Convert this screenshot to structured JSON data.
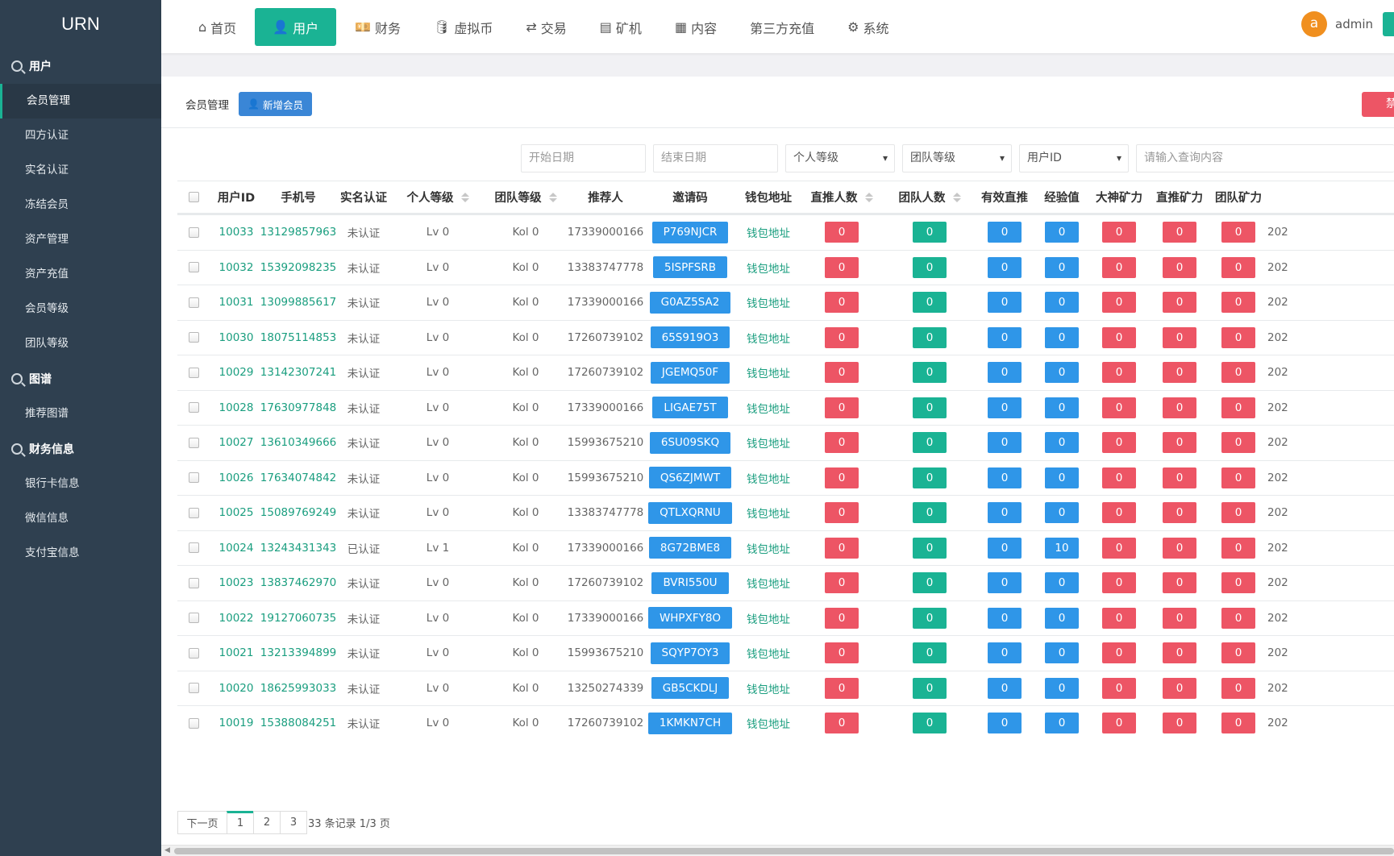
{
  "brand": "URN",
  "sidebar": {
    "groups": [
      {
        "label": "用户",
        "items": [
          "会员管理",
          "四方认证",
          "实名认证",
          "冻结会员",
          "资产管理",
          "资产充值",
          "会员等级",
          "团队等级"
        ]
      },
      {
        "label": "图谱",
        "items": [
          "推荐图谱"
        ]
      },
      {
        "label": "财务信息",
        "items": [
          "银行卡信息",
          "微信信息",
          "支付宝信息"
        ]
      }
    ],
    "active_item": "会员管理"
  },
  "topnav": {
    "items": [
      {
        "label": "首页",
        "icon": "home-icon",
        "glyph": "⌂"
      },
      {
        "label": "用户",
        "icon": "user-icon",
        "glyph": "👤"
      },
      {
        "label": "财务",
        "icon": "money-icon",
        "glyph": "💴"
      },
      {
        "label": "虚拟币",
        "icon": "database-icon",
        "glyph": "🛢"
      },
      {
        "label": "交易",
        "icon": "exchange-icon",
        "glyph": "⇄"
      },
      {
        "label": "矿机",
        "icon": "server-icon",
        "glyph": "▤"
      },
      {
        "label": "内容",
        "icon": "document-icon",
        "glyph": "▦"
      },
      {
        "label": "第三方充值",
        "icon": "",
        "glyph": ""
      },
      {
        "label": "系统",
        "icon": "gear-icon",
        "glyph": "⚙"
      }
    ],
    "active": "用户",
    "avatar_letter": "a",
    "username": "admin"
  },
  "page": {
    "crumb": "会员管理",
    "add_button": "新增会员",
    "ban_button": "禁止"
  },
  "filters": {
    "start_date": "开始日期",
    "end_date": "结束日期",
    "personal_level": "个人等级",
    "team_level": "团队等级",
    "field_select": "用户ID",
    "search": "请输入查询内容"
  },
  "table": {
    "columns": [
      "用户ID",
      "手机号",
      "实名认证",
      "个人等级",
      "团队等级",
      "推荐人",
      "邀请码",
      "钱包地址",
      "直推人数",
      "团队人数",
      "有效直推",
      "经验值",
      "大神矿力",
      "直推矿力",
      "团队矿力",
      "202"
    ],
    "rows": [
      {
        "id": "10033",
        "phone": "13129857963",
        "verified": "未认证",
        "plevel": "Lv 0",
        "tlevel": "Kol 0",
        "referrer": "17339000166",
        "code": "P769NJCR",
        "wallet": "钱包地址",
        "direct": "0",
        "team": "0",
        "valid": "0",
        "exp": "0",
        "god": "0",
        "dpower": "0",
        "tpower": "0",
        "date": "202"
      },
      {
        "id": "10032",
        "phone": "15392098235",
        "verified": "未认证",
        "plevel": "Lv 0",
        "tlevel": "Kol 0",
        "referrer": "13383747778",
        "code": "5ISPFSRB",
        "wallet": "钱包地址",
        "direct": "0",
        "team": "0",
        "valid": "0",
        "exp": "0",
        "god": "0",
        "dpower": "0",
        "tpower": "0",
        "date": "202"
      },
      {
        "id": "10031",
        "phone": "13099885617",
        "verified": "未认证",
        "plevel": "Lv 0",
        "tlevel": "Kol 0",
        "referrer": "17339000166",
        "code": "G0AZ5SA2",
        "wallet": "钱包地址",
        "direct": "0",
        "team": "0",
        "valid": "0",
        "exp": "0",
        "god": "0",
        "dpower": "0",
        "tpower": "0",
        "date": "202"
      },
      {
        "id": "10030",
        "phone": "18075114853",
        "verified": "未认证",
        "plevel": "Lv 0",
        "tlevel": "Kol 0",
        "referrer": "17260739102",
        "code": "65S919O3",
        "wallet": "钱包地址",
        "direct": "0",
        "team": "0",
        "valid": "0",
        "exp": "0",
        "god": "0",
        "dpower": "0",
        "tpower": "0",
        "date": "202"
      },
      {
        "id": "10029",
        "phone": "13142307241",
        "verified": "未认证",
        "plevel": "Lv 0",
        "tlevel": "Kol 0",
        "referrer": "17260739102",
        "code": "JGEMQ50F",
        "wallet": "钱包地址",
        "direct": "0",
        "team": "0",
        "valid": "0",
        "exp": "0",
        "god": "0",
        "dpower": "0",
        "tpower": "0",
        "date": "202"
      },
      {
        "id": "10028",
        "phone": "17630977848",
        "verified": "未认证",
        "plevel": "Lv 0",
        "tlevel": "Kol 0",
        "referrer": "17339000166",
        "code": "LIGAE75T",
        "wallet": "钱包地址",
        "direct": "0",
        "team": "0",
        "valid": "0",
        "exp": "0",
        "god": "0",
        "dpower": "0",
        "tpower": "0",
        "date": "202"
      },
      {
        "id": "10027",
        "phone": "13610349666",
        "verified": "未认证",
        "plevel": "Lv 0",
        "tlevel": "Kol 0",
        "referrer": "15993675210",
        "code": "6SU09SKQ",
        "wallet": "钱包地址",
        "direct": "0",
        "team": "0",
        "valid": "0",
        "exp": "0",
        "god": "0",
        "dpower": "0",
        "tpower": "0",
        "date": "202"
      },
      {
        "id": "10026",
        "phone": "17634074842",
        "verified": "未认证",
        "plevel": "Lv 0",
        "tlevel": "Kol 0",
        "referrer": "15993675210",
        "code": "QS6ZJMWT",
        "wallet": "钱包地址",
        "direct": "0",
        "team": "0",
        "valid": "0",
        "exp": "0",
        "god": "0",
        "dpower": "0",
        "tpower": "0",
        "date": "202"
      },
      {
        "id": "10025",
        "phone": "15089769249",
        "verified": "未认证",
        "plevel": "Lv 0",
        "tlevel": "Kol 0",
        "referrer": "13383747778",
        "code": "QTLXQRNU",
        "wallet": "钱包地址",
        "direct": "0",
        "team": "0",
        "valid": "0",
        "exp": "0",
        "god": "0",
        "dpower": "0",
        "tpower": "0",
        "date": "202"
      },
      {
        "id": "10024",
        "phone": "13243431343",
        "verified": "已认证",
        "plevel": "Lv 1",
        "tlevel": "Kol 0",
        "referrer": "17339000166",
        "code": "8G72BME8",
        "wallet": "钱包地址",
        "direct": "0",
        "team": "0",
        "valid": "0",
        "exp": "10",
        "god": "0",
        "dpower": "0",
        "tpower": "0",
        "date": "202"
      },
      {
        "id": "10023",
        "phone": "13837462970",
        "verified": "未认证",
        "plevel": "Lv 0",
        "tlevel": "Kol 0",
        "referrer": "17260739102",
        "code": "BVRI550U",
        "wallet": "钱包地址",
        "direct": "0",
        "team": "0",
        "valid": "0",
        "exp": "0",
        "god": "0",
        "dpower": "0",
        "tpower": "0",
        "date": "202"
      },
      {
        "id": "10022",
        "phone": "19127060735",
        "verified": "未认证",
        "plevel": "Lv 0",
        "tlevel": "Kol 0",
        "referrer": "17339000166",
        "code": "WHPXFY8O",
        "wallet": "钱包地址",
        "direct": "0",
        "team": "0",
        "valid": "0",
        "exp": "0",
        "god": "0",
        "dpower": "0",
        "tpower": "0",
        "date": "202"
      },
      {
        "id": "10021",
        "phone": "13213394899",
        "verified": "未认证",
        "plevel": "Lv 0",
        "tlevel": "Kol 0",
        "referrer": "15993675210",
        "code": "SQYP7OY3",
        "wallet": "钱包地址",
        "direct": "0",
        "team": "0",
        "valid": "0",
        "exp": "0",
        "god": "0",
        "dpower": "0",
        "tpower": "0",
        "date": "202"
      },
      {
        "id": "10020",
        "phone": "18625993033",
        "verified": "未认证",
        "plevel": "Lv 0",
        "tlevel": "Kol 0",
        "referrer": "13250274339",
        "code": "GB5CKDLJ",
        "wallet": "钱包地址",
        "direct": "0",
        "team": "0",
        "valid": "0",
        "exp": "0",
        "god": "0",
        "dpower": "0",
        "tpower": "0",
        "date": "202"
      },
      {
        "id": "10019",
        "phone": "15388084251",
        "verified": "未认证",
        "plevel": "Lv 0",
        "tlevel": "Kol 0",
        "referrer": "17260739102",
        "code": "1KMKN7CH",
        "wallet": "钱包地址",
        "direct": "0",
        "team": "0",
        "valid": "0",
        "exp": "0",
        "god": "0",
        "dpower": "0",
        "tpower": "0",
        "date": "202"
      }
    ]
  },
  "pagination": {
    "prev": "下一页",
    "pages": [
      "1",
      "2",
      "3"
    ],
    "current": "1",
    "info": "33 条记录 1/3 页"
  },
  "colors": {
    "primary": "#1ab394",
    "sidebar": "#2f4050",
    "blue": "#3a86d6",
    "red": "#ed5565",
    "avatar": "#f08f1f"
  }
}
